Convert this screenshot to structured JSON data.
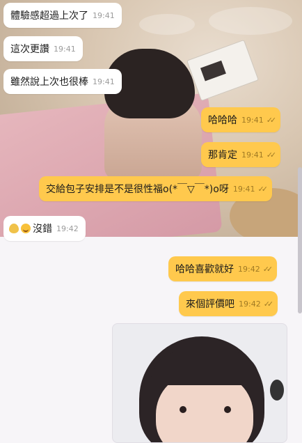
{
  "messages": [
    {
      "text": "體驗感超過上次了",
      "time": "19:41"
    },
    {
      "text": "這次更讚",
      "time": "19:41"
    },
    {
      "text": "雖然說上次也很棒",
      "time": "19:41"
    },
    {
      "text": "哈哈哈",
      "time": "19:41"
    },
    {
      "text": "那肯定",
      "time": "19:41"
    },
    {
      "text": "交給包子安排是不是很性福o(*￣▽￣*)o呀",
      "time": "19:41"
    },
    {
      "text": "沒錯",
      "time": "19:42"
    },
    {
      "text": "哈哈喜歡就好",
      "time": "19:42"
    },
    {
      "text": "來個評價吧",
      "time": "19:42"
    }
  ],
  "colors": {
    "outgoing_bubble": "#ffc94d",
    "incoming_bubble": "#ffffff"
  },
  "icons": {
    "read_receipt": "double-check-icon",
    "emoji1": "pear-emoji-icon",
    "emoji2": "smile-emoji-icon"
  }
}
